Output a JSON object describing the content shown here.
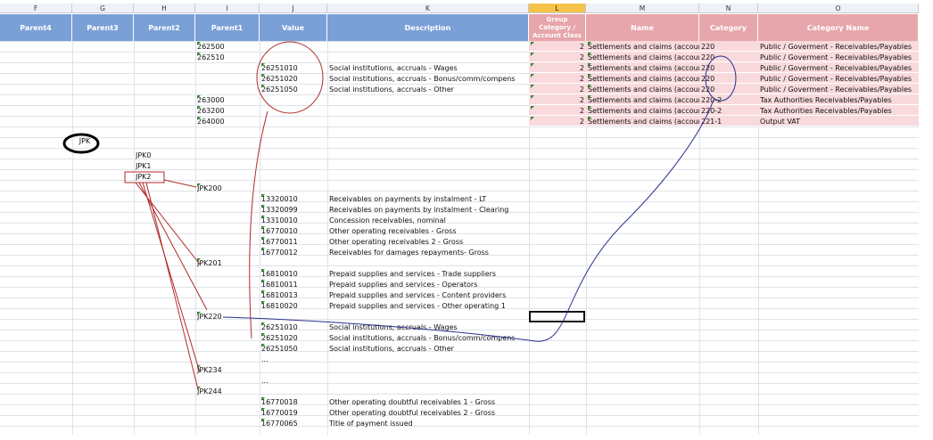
{
  "columns": {
    "letters": [
      "F",
      "G",
      "H",
      "I",
      "J",
      "K",
      "L",
      "M",
      "N",
      "O"
    ],
    "headers": {
      "parent4": "Parent4",
      "parent3": "Parent3",
      "parent2": "Parent2",
      "parent1": "Parent1",
      "value": "Value",
      "description": "Description",
      "group": "Group Category / Account Class",
      "name": "Name",
      "category": "Category",
      "category_name": "Category Name"
    }
  },
  "top_rows": [
    {
      "parent1": "262500",
      "group": "2",
      "name": "Settlements and claims (account",
      "category": "220",
      "category_name": "Public / Goverment - Receivables/Payables"
    },
    {
      "parent1": "262510",
      "group": "2",
      "name": "Settlements and claims (account",
      "category": "220",
      "category_name": "Public / Goverment - Receivables/Payables"
    },
    {
      "value": "26251010",
      "description": "Social institutions, accruals - Wages",
      "group": "2",
      "name": "Settlements and claims (account",
      "category": "220",
      "category_name": "Public / Goverment - Receivables/Payables"
    },
    {
      "value": "26251020",
      "description": "Social institutions, accruals - Bonus/comm/compens",
      "group": "2",
      "name": "Settlements and claims (account",
      "category": "220",
      "category_name": "Public / Goverment - Receivables/Payables"
    },
    {
      "value": "26251050",
      "description": "Social institutions, accruals - Other",
      "group": "2",
      "name": "Settlements and claims (account",
      "category": "220",
      "category_name": "Public / Goverment - Receivables/Payables"
    },
    {
      "parent1": "263000",
      "group": "2",
      "name": "Settlements and claims (account",
      "category": "220-2",
      "category_name": "Tax Authorities Receivables/Payables"
    },
    {
      "parent1": "263200",
      "group": "2",
      "name": "Settlements and claims (account",
      "category": "220-2",
      "category_name": "Tax Authorities Receivables/Payables"
    },
    {
      "parent1": "264000",
      "group": "2",
      "name": "Settlements and claims (account",
      "category": "221-1",
      "category_name": "Output VAT"
    }
  ],
  "jpk_label": "JPK",
  "parent2_items": [
    "JPK0",
    "JPK1",
    "JPK2"
  ],
  "lower_rows": [
    {
      "parent1": "JPK200"
    },
    {
      "value": "13320010",
      "description": "Receivables on payments by instalment - LT"
    },
    {
      "value": "13320099",
      "description": "Receivables on payments by instalment - Clearing"
    },
    {
      "value": "13310010",
      "description": "Concession receivables, nominal"
    },
    {
      "value": "16770010",
      "description": "Other operating receivables - Gross"
    },
    {
      "value": "16770011",
      "description": "Other operating receivables 2 - Gross"
    },
    {
      "value": "16770012",
      "description": "Receivables for damages repayments- Gross"
    },
    {
      "parent1": "JPK201"
    },
    {
      "value": "16810010",
      "description": "Prepaid supplies and services - Trade suppliers"
    },
    {
      "value": "16810011",
      "description": "Prepaid supplies and services - Operators"
    },
    {
      "value": "16810013",
      "description": "Prepaid supplies and services - Content providers"
    },
    {
      "value": "16810020",
      "description": "Prepaid supplies and services - Other operating 1"
    },
    {
      "parent1": "JPK220"
    },
    {
      "value": "26251010",
      "description": "Social institutions, accruals - Wages"
    },
    {
      "value": "26251020",
      "description": "Social institutions, accruals - Bonus/comm/compens"
    },
    {
      "value": "26251050",
      "description": "Social institutions, accruals - Other"
    },
    {
      "value": "..."
    },
    {
      "parent1": "JPK234"
    },
    {
      "value": "..."
    },
    {
      "parent1": "JPK244"
    },
    {
      "value": "16770018",
      "description": "Other operating doubtful receivables 1 - Gross"
    },
    {
      "value": "16770019",
      "description": "Other operating doubtful receivables 2 - Gross"
    },
    {
      "value": "16770065",
      "description": "Title of payment issued"
    }
  ],
  "colors": {
    "header_blue": "#7aa0d6",
    "header_pink": "#e7a6ab",
    "row_pink": "#f8dadd",
    "annotation_red": "#b02a2a",
    "annotation_blue": "#2a2f8a",
    "active_column": "#f6c24a"
  }
}
